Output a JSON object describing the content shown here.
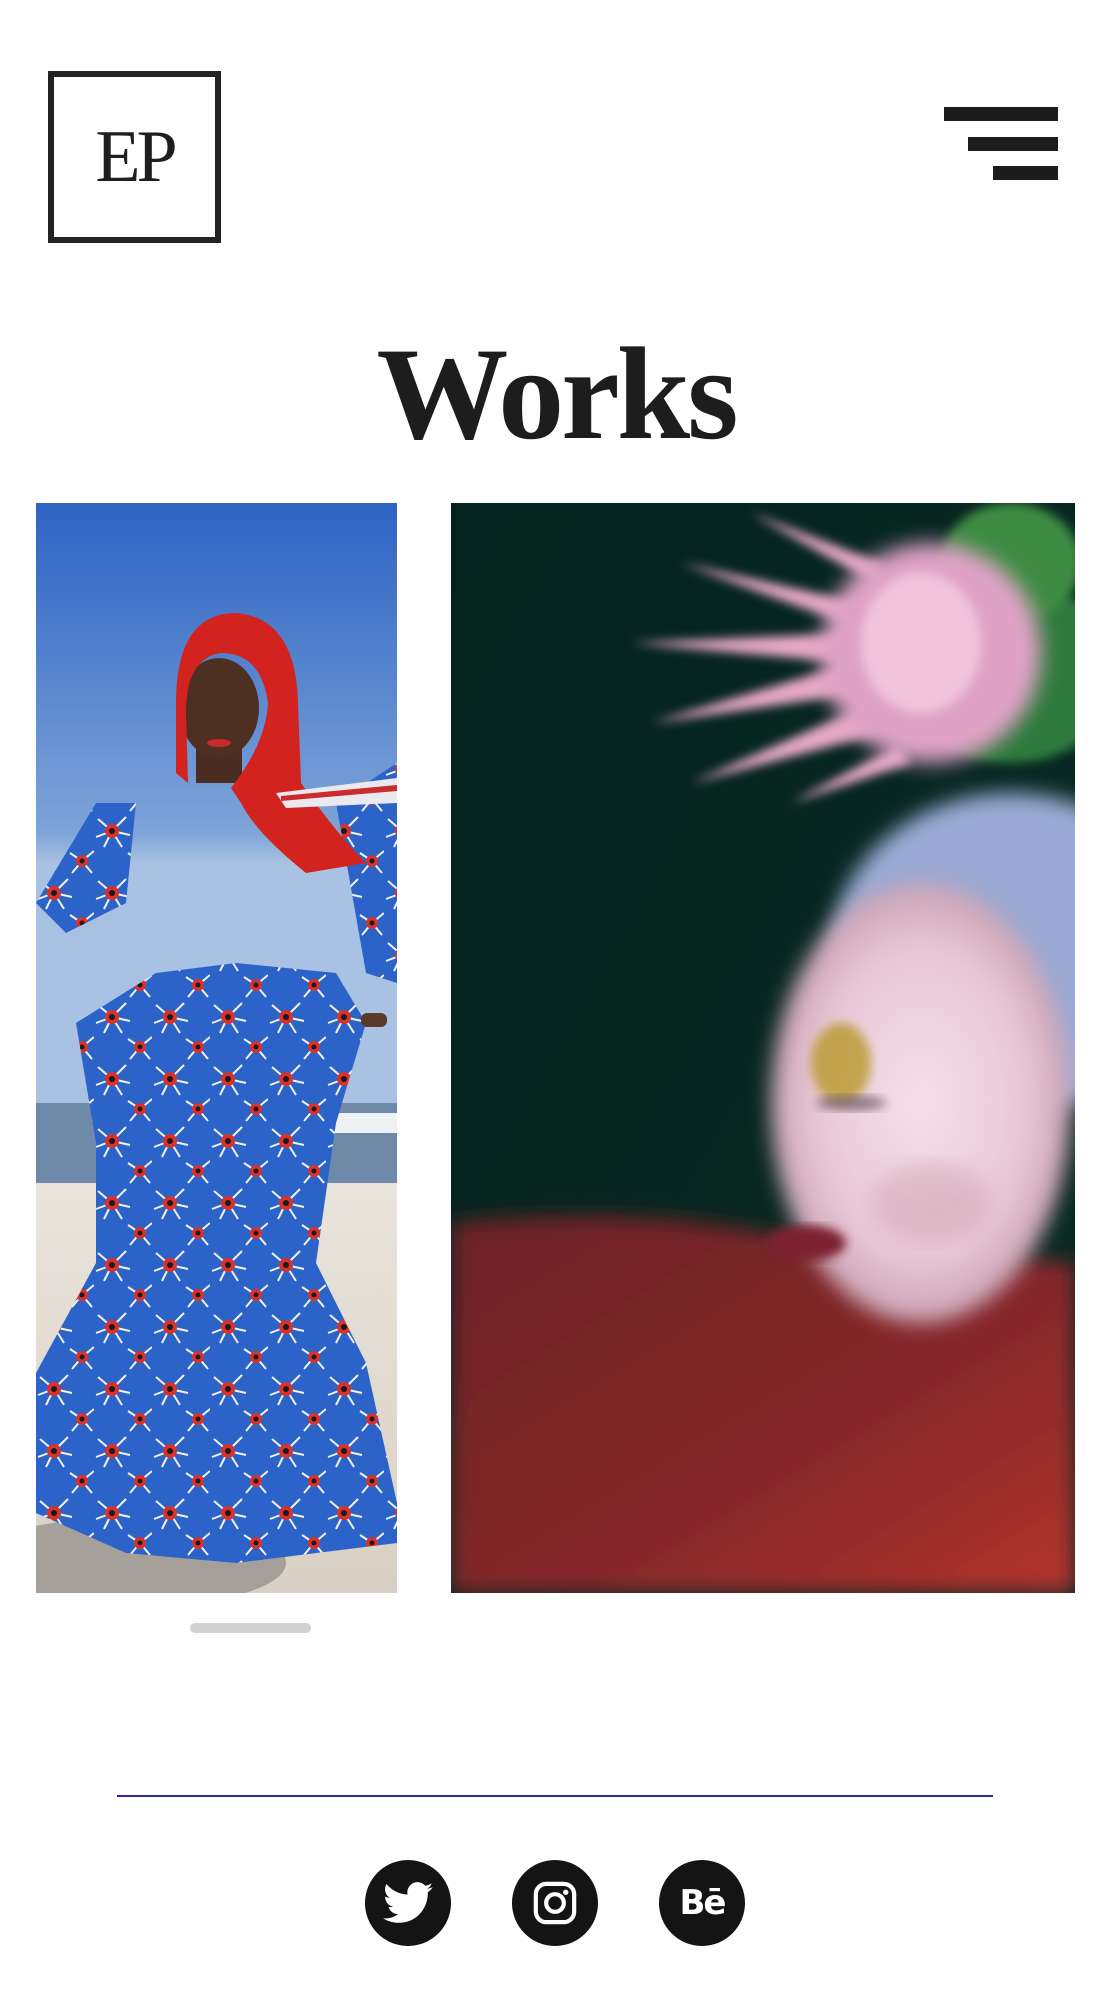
{
  "header": {
    "logo_text": "EP",
    "menu_icon": "hamburger-menu-icon"
  },
  "page": {
    "title": "Works"
  },
  "works": [
    {
      "name": "work-fashion-beach",
      "colors": [
        "#2b5fc6",
        "#d93a2e",
        "#e8e2d9"
      ]
    },
    {
      "name": "work-flower-portrait",
      "colors": [
        "#06201b",
        "#8a2a2c",
        "#e3b7c8"
      ]
    }
  ],
  "slider": {
    "scroll_position": 0.0
  },
  "footer": {
    "social": [
      {
        "name": "twitter",
        "icon": "twitter-icon"
      },
      {
        "name": "instagram",
        "icon": "instagram-icon"
      },
      {
        "name": "behance",
        "icon": "behance-icon",
        "label": "Bē"
      }
    ],
    "divider_color": "#2e29a0"
  }
}
